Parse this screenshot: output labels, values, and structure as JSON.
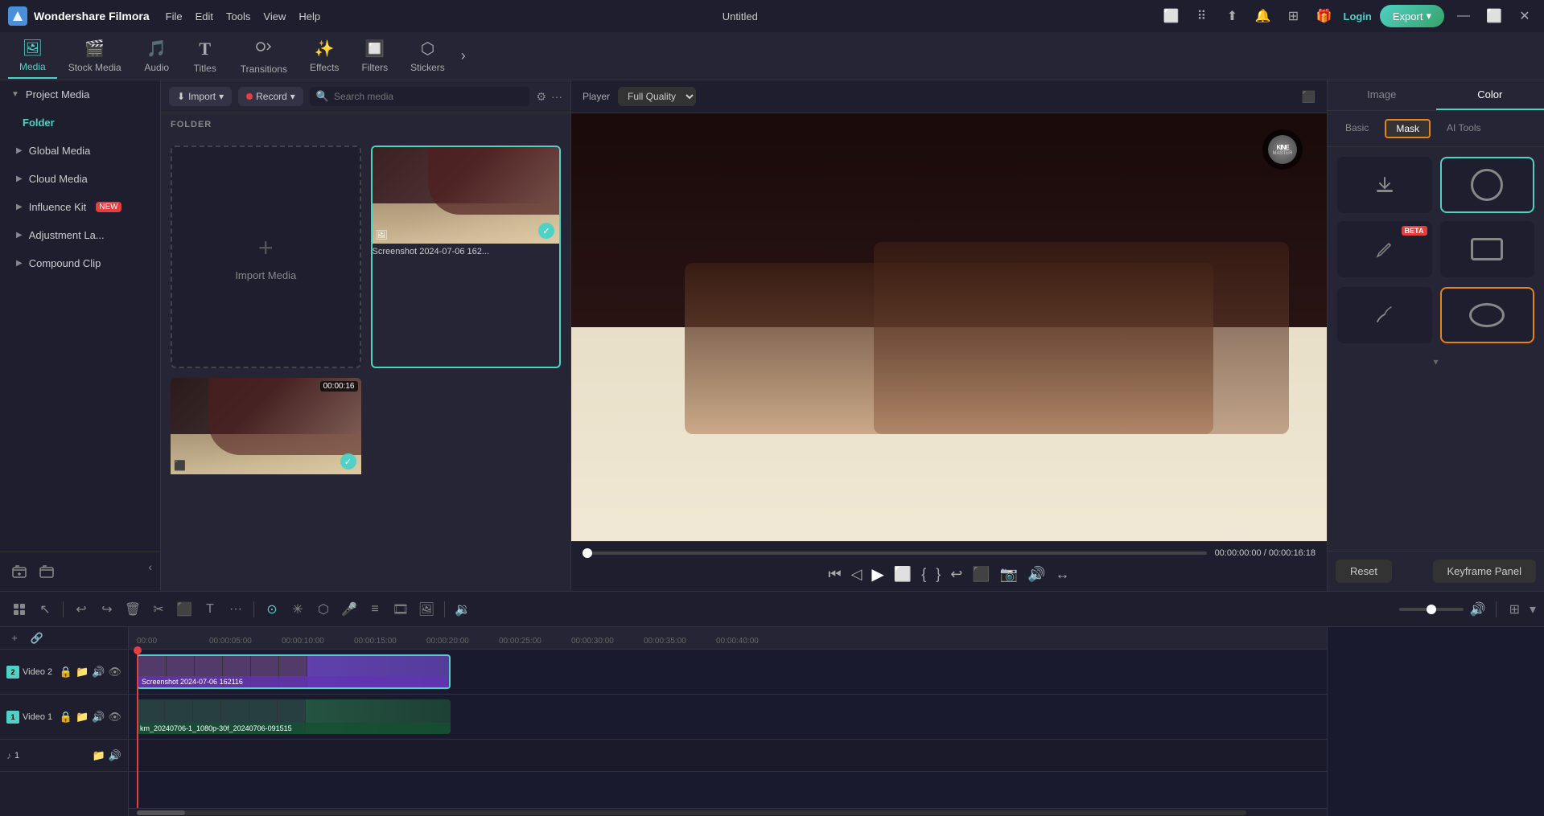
{
  "app": {
    "name": "Wondershare Filmora",
    "title": "Untitled",
    "logo_letter": "W"
  },
  "menu": {
    "items": [
      "File",
      "Edit",
      "Tools",
      "View",
      "Help"
    ],
    "right_icons": [
      "monitor",
      "grid",
      "cloud-upload",
      "bell",
      "grid2",
      "gift"
    ],
    "login_label": "Login",
    "export_label": "Export"
  },
  "tabs": [
    {
      "id": "media",
      "label": "Media",
      "icon": "🖼",
      "active": true
    },
    {
      "id": "stock",
      "label": "Stock Media",
      "icon": "🎬"
    },
    {
      "id": "audio",
      "label": "Audio",
      "icon": "🎵"
    },
    {
      "id": "titles",
      "label": "Titles",
      "icon": "T"
    },
    {
      "id": "transitions",
      "label": "Transitions",
      "icon": "↔"
    },
    {
      "id": "effects",
      "label": "Effects",
      "icon": "✨"
    },
    {
      "id": "filters",
      "label": "Filters",
      "icon": "🔲"
    },
    {
      "id": "stickers",
      "label": "Stickers",
      "icon": "🎯"
    }
  ],
  "sidebar": {
    "items": [
      {
        "id": "project-media",
        "label": "Project Media",
        "has_arrow": true,
        "expanded": true
      },
      {
        "id": "folder",
        "label": "Folder",
        "active": true
      },
      {
        "id": "global-media",
        "label": "Global Media",
        "has_arrow": true
      },
      {
        "id": "cloud-media",
        "label": "Cloud Media",
        "has_arrow": true
      },
      {
        "id": "influence-kit",
        "label": "Influence Kit",
        "has_arrow": true,
        "badge": "NEW"
      },
      {
        "id": "adjustment-la",
        "label": "Adjustment La...",
        "has_arrow": true
      },
      {
        "id": "compound-clip",
        "label": "Compound Clip",
        "has_arrow": true
      }
    ],
    "bottom_icons": [
      "folder-plus",
      "folder"
    ]
  },
  "media_panel": {
    "import_btn": "Import",
    "record_btn": "Record",
    "search_placeholder": "Search media",
    "folder_header": "FOLDER",
    "items": [
      {
        "id": "import",
        "type": "import",
        "label": "Import Media"
      },
      {
        "id": "clip1",
        "type": "video",
        "label": "Screenshot 2024-07-06 162...",
        "selected": true,
        "checked": true
      },
      {
        "id": "clip2",
        "type": "video",
        "label": "",
        "duration": "00:00:16",
        "checked": true
      }
    ]
  },
  "player": {
    "label": "Player",
    "quality": "Full Quality",
    "current_time": "00:00:00:00",
    "total_time": "00:00:16:18",
    "progress": 0
  },
  "right_panel": {
    "tabs": [
      "Image",
      "Color"
    ],
    "active_tab": "Image",
    "mask_tabs": [
      "Basic",
      "Mask",
      "AI Tools"
    ],
    "active_mask_tab": "Mask",
    "mask_items": [
      {
        "id": "download",
        "icon": "⬇",
        "selected": false
      },
      {
        "id": "circle",
        "shape": "circle",
        "selected": true
      },
      {
        "id": "pen",
        "icon": "✏",
        "beta": true,
        "selected": false
      },
      {
        "id": "rect",
        "shape": "rect",
        "selected": false
      },
      {
        "id": "oval",
        "shape": "oval",
        "selected": true,
        "orange": true
      }
    ],
    "reset_label": "Reset",
    "keyframe_label": "Keyframe Panel"
  },
  "timeline": {
    "ruler_ticks": [
      "00:00",
      "00:00:05:00",
      "00:00:10:00",
      "00:00:15:00",
      "00:00:20:00",
      "00:00:25:00",
      "00:00:30:00",
      "00:00:35:00",
      "00:00:40:00"
    ],
    "tracks": [
      {
        "id": "video2",
        "label": "Video 2",
        "num": 2,
        "clip": "Screenshot 2024-07-06 162116"
      },
      {
        "id": "video1",
        "label": "Video 1",
        "num": 1,
        "clip": "km_20240706-1_1080p-30f_20240706-091515"
      },
      {
        "id": "audio1",
        "label": "♪ 1",
        "num": null
      }
    ],
    "toolbar_icons": [
      "grid2",
      "cursor",
      "undo",
      "redo",
      "trash",
      "scissors",
      "crop",
      "text",
      "more",
      "dot-circle",
      "asterisk",
      "shield",
      "mic",
      "layers",
      "film",
      "image",
      "volume-down",
      "circle",
      "volume-up",
      "grid3",
      "chevron-down"
    ]
  }
}
